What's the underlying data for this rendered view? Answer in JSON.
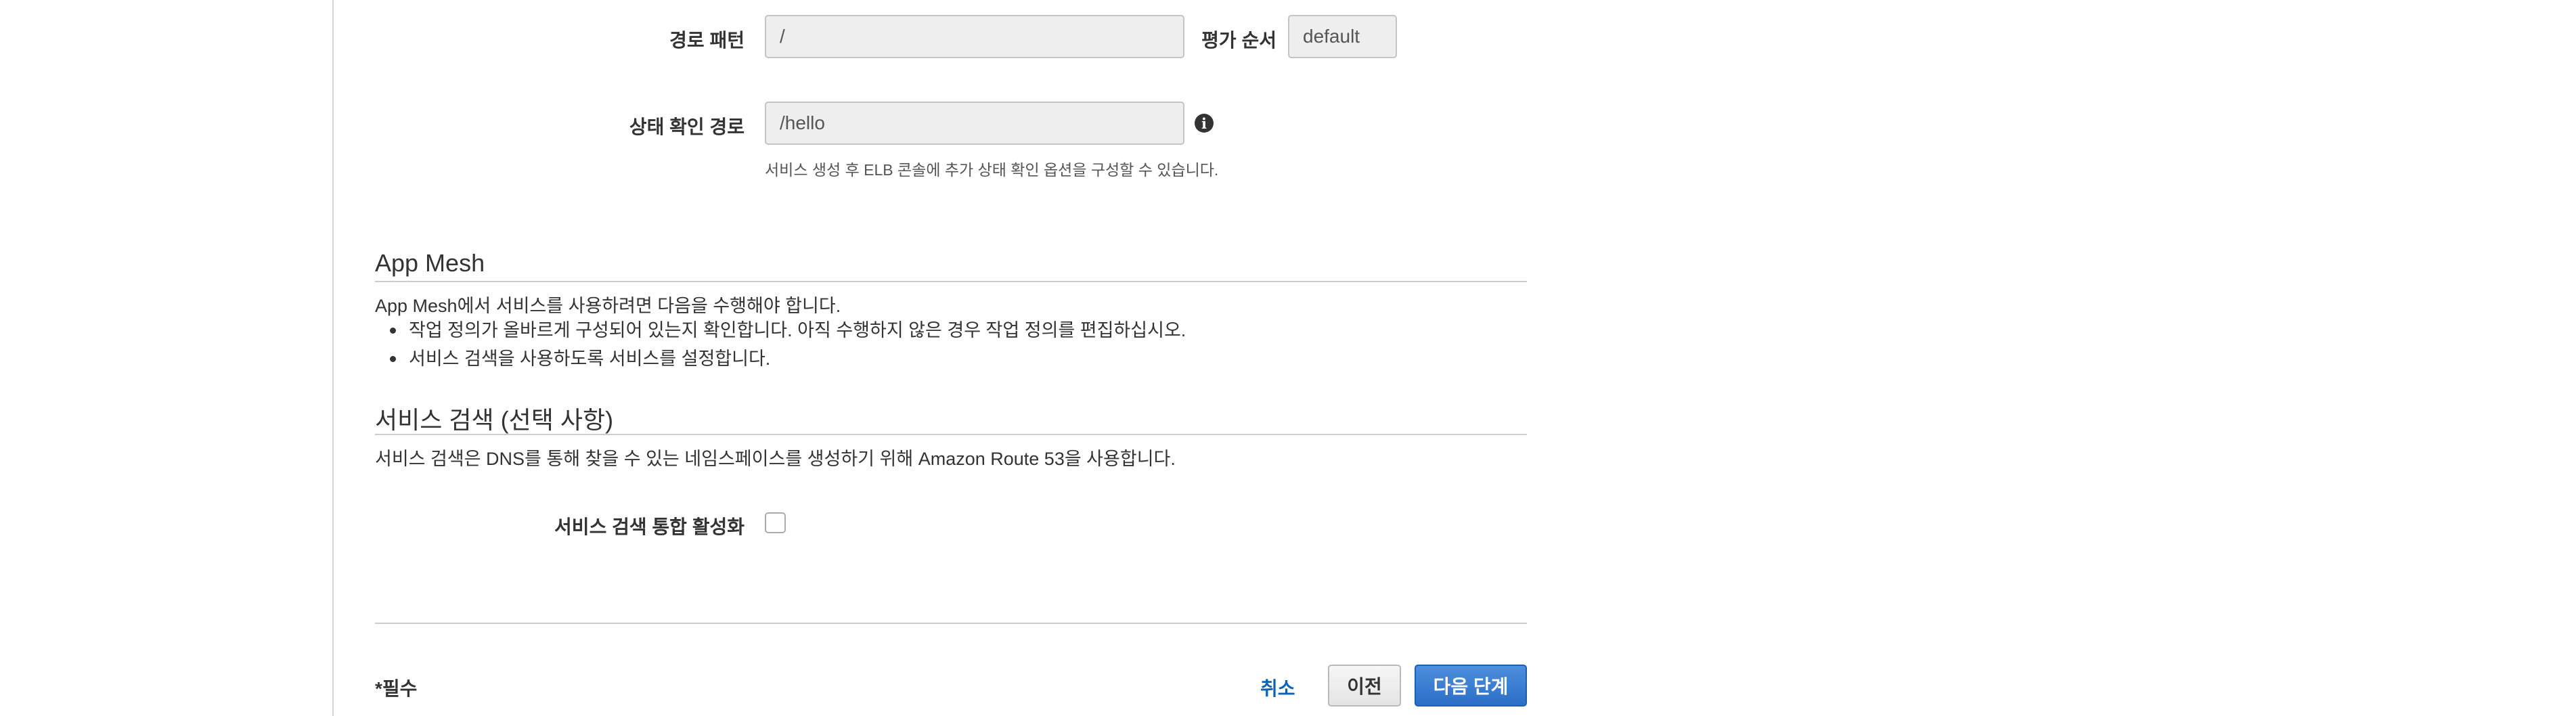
{
  "load_balancer": {
    "path_pattern_label": "경로 패턴",
    "path_pattern_value": "/",
    "eval_order_label": "평가 순서",
    "eval_order_value": "default",
    "health_check_label": "상태 확인 경로",
    "health_check_value": "/hello",
    "health_check_help": "서비스 생성 후 ELB 콘솔에 추가 상태 확인 옵션을 구성할 수 있습니다."
  },
  "app_mesh": {
    "title": "App Mesh",
    "description": "App Mesh에서 서비스를 사용하려면 다음을 수행해야 합니다.",
    "bullets": [
      "작업 정의가 올바르게 구성되어 있는지 확인합니다. 아직 수행하지 않은 경우 작업 정의를 편집하십시오.",
      "서비스 검색을 사용하도록 서비스를 설정합니다."
    ]
  },
  "service_discovery": {
    "title": "서비스 검색 (선택 사항)",
    "description": "서비스 검색은 DNS를 통해 찾을 수 있는 네임스페이스를 생성하기 위해 Amazon Route 53을 사용합니다.",
    "enable_label": "서비스 검색 통합 활성화",
    "enable_checked": false
  },
  "footer": {
    "required_note": "*필수",
    "cancel_label": "취소",
    "previous_label": "이전",
    "next_label": "다음 단계"
  },
  "colors": {
    "link": "#0a63b8",
    "primary_button": "#2c6ec8"
  }
}
